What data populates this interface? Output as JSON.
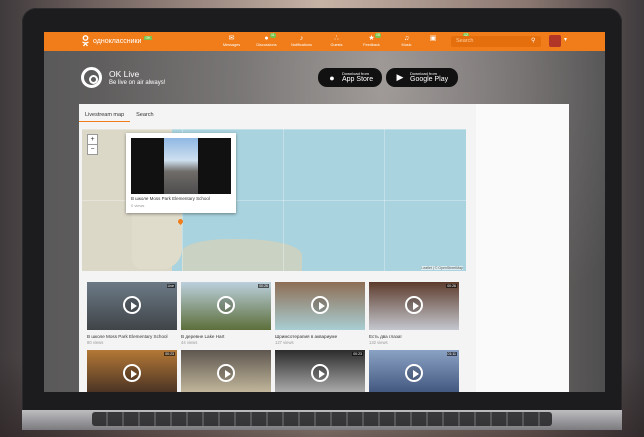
{
  "brand": {
    "name": "одноклассники",
    "badge": "OK"
  },
  "nav": [
    {
      "label": "Messages",
      "icon": "envelope-icon",
      "badge": ""
    },
    {
      "label": "Discussions",
      "icon": "chat-icon",
      "badge": "11"
    },
    {
      "label": "Notifications",
      "icon": "bell-icon",
      "badge": ""
    },
    {
      "label": "Guests",
      "icon": "footprints-icon",
      "badge": ""
    },
    {
      "label": "Feedback",
      "icon": "feedback-icon",
      "badge": "15"
    },
    {
      "label": "Music",
      "icon": "music-icon",
      "badge": ""
    },
    {
      "label": "",
      "icon": "radio-icon",
      "badge": ""
    },
    {
      "label": "Video",
      "icon": "video-icon",
      "badge": "12"
    }
  ],
  "search": {
    "placeholder": "Search"
  },
  "promo": {
    "title": "OK Live",
    "subtitle": "Be live on air always!"
  },
  "stores": {
    "apple": {
      "small": "Download from",
      "big": "App Store"
    },
    "google": {
      "small": "Download from",
      "big": "Google Play"
    }
  },
  "tabs": [
    "Livestream map",
    "Search"
  ],
  "map": {
    "zoom_in": "+",
    "zoom_out": "−",
    "popup": {
      "title": "В школе Moss Park Elementary School",
      "views": "0 views"
    },
    "attribution": "Leaflet | © OpenStreetMap"
  },
  "videos": [
    {
      "title": "В школе Moss Park Elementary School",
      "views": "80 views",
      "badge": "Live",
      "colors": [
        "#6c7a86",
        "#404448"
      ]
    },
    {
      "title": "В деревне Lake Hart",
      "views": "44 views",
      "badge": "00:26",
      "colors": [
        "#bcd0dd",
        "#5c6f3a"
      ]
    },
    {
      "title": "Шримсотерапия в аквариуме",
      "views": "127 views",
      "badge": "",
      "colors": [
        "#8d6e55",
        "#a9ced3"
      ]
    },
    {
      "title": "Есть два глаза!",
      "views": "132 views",
      "badge": "00:26",
      "colors": [
        "#5d3c2c",
        "#c4c7cf"
      ]
    },
    {
      "title": "",
      "views": "",
      "badge": "00:23",
      "colors": [
        "#b47836",
        "#3d2b22"
      ]
    },
    {
      "title": "",
      "views": "",
      "badge": "",
      "colors": [
        "#5e574f",
        "#cfc3a6"
      ]
    },
    {
      "title": "",
      "views": "",
      "badge": "00:23",
      "colors": [
        "#2c2c2c",
        "#bdbcbc"
      ]
    },
    {
      "title": "",
      "views": "",
      "badge": "01:11",
      "colors": [
        "#8aa2c4",
        "#3a4e76"
      ]
    }
  ]
}
